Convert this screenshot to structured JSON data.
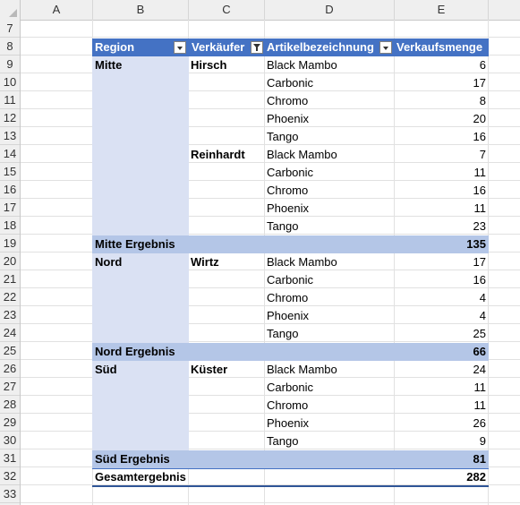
{
  "columns": [
    "A",
    "B",
    "C",
    "D",
    "E"
  ],
  "rows": [
    "7",
    "8",
    "9",
    "10",
    "11",
    "12",
    "13",
    "14",
    "15",
    "16",
    "17",
    "18",
    "19",
    "20",
    "21",
    "22",
    "23",
    "24",
    "25",
    "26",
    "27",
    "28",
    "29",
    "30",
    "31",
    "32",
    "33"
  ],
  "pivot": {
    "headers": {
      "region": "Region",
      "seller": "Verkäufer",
      "item": "Artikelbezeichnung",
      "qty": "Verkaufsmenge"
    },
    "lines": [
      {
        "region": "Mitte",
        "seller": "Hirsch",
        "item": "Black Mambo",
        "qty": "6"
      },
      {
        "region": "",
        "seller": "",
        "item": "Carbonic",
        "qty": "17"
      },
      {
        "region": "",
        "seller": "",
        "item": "Chromo",
        "qty": "8"
      },
      {
        "region": "",
        "seller": "",
        "item": "Phoenix",
        "qty": "20"
      },
      {
        "region": "",
        "seller": "",
        "item": "Tango",
        "qty": "16"
      },
      {
        "region": "",
        "seller": "Reinhardt",
        "item": "Black Mambo",
        "qty": "7"
      },
      {
        "region": "",
        "seller": "",
        "item": "Carbonic",
        "qty": "11"
      },
      {
        "region": "",
        "seller": "",
        "item": "Chromo",
        "qty": "16"
      },
      {
        "region": "",
        "seller": "",
        "item": "Phoenix",
        "qty": "11"
      },
      {
        "region": "",
        "seller": "",
        "item": "Tango",
        "qty": "23"
      },
      {
        "subtotal": "Mitte Ergebnis",
        "qty": "135"
      },
      {
        "region": "Nord",
        "seller": "Wirtz",
        "item": "Black Mambo",
        "qty": "17"
      },
      {
        "region": "",
        "seller": "",
        "item": "Carbonic",
        "qty": "16"
      },
      {
        "region": "",
        "seller": "",
        "item": "Chromo",
        "qty": "4"
      },
      {
        "region": "",
        "seller": "",
        "item": "Phoenix",
        "qty": "4"
      },
      {
        "region": "",
        "seller": "",
        "item": "Tango",
        "qty": "25"
      },
      {
        "subtotal": "Nord Ergebnis",
        "qty": "66"
      },
      {
        "region": "Süd",
        "seller": "Küster",
        "item": "Black Mambo",
        "qty": "24"
      },
      {
        "region": "",
        "seller": "",
        "item": "Carbonic",
        "qty": "11"
      },
      {
        "region": "",
        "seller": "",
        "item": "Chromo",
        "qty": "11"
      },
      {
        "region": "",
        "seller": "",
        "item": "Phoenix",
        "qty": "26"
      },
      {
        "region": "",
        "seller": "",
        "item": "Tango",
        "qty": "9"
      },
      {
        "subtotal": "Süd Ergebnis",
        "qty": "81"
      }
    ],
    "grand_total": {
      "label": "Gesamtergebnis",
      "qty": "282"
    }
  },
  "colors": {
    "header": "#4472c4",
    "region_fill": "#dae1f3",
    "subtotal_fill": "#b4c6e7"
  }
}
